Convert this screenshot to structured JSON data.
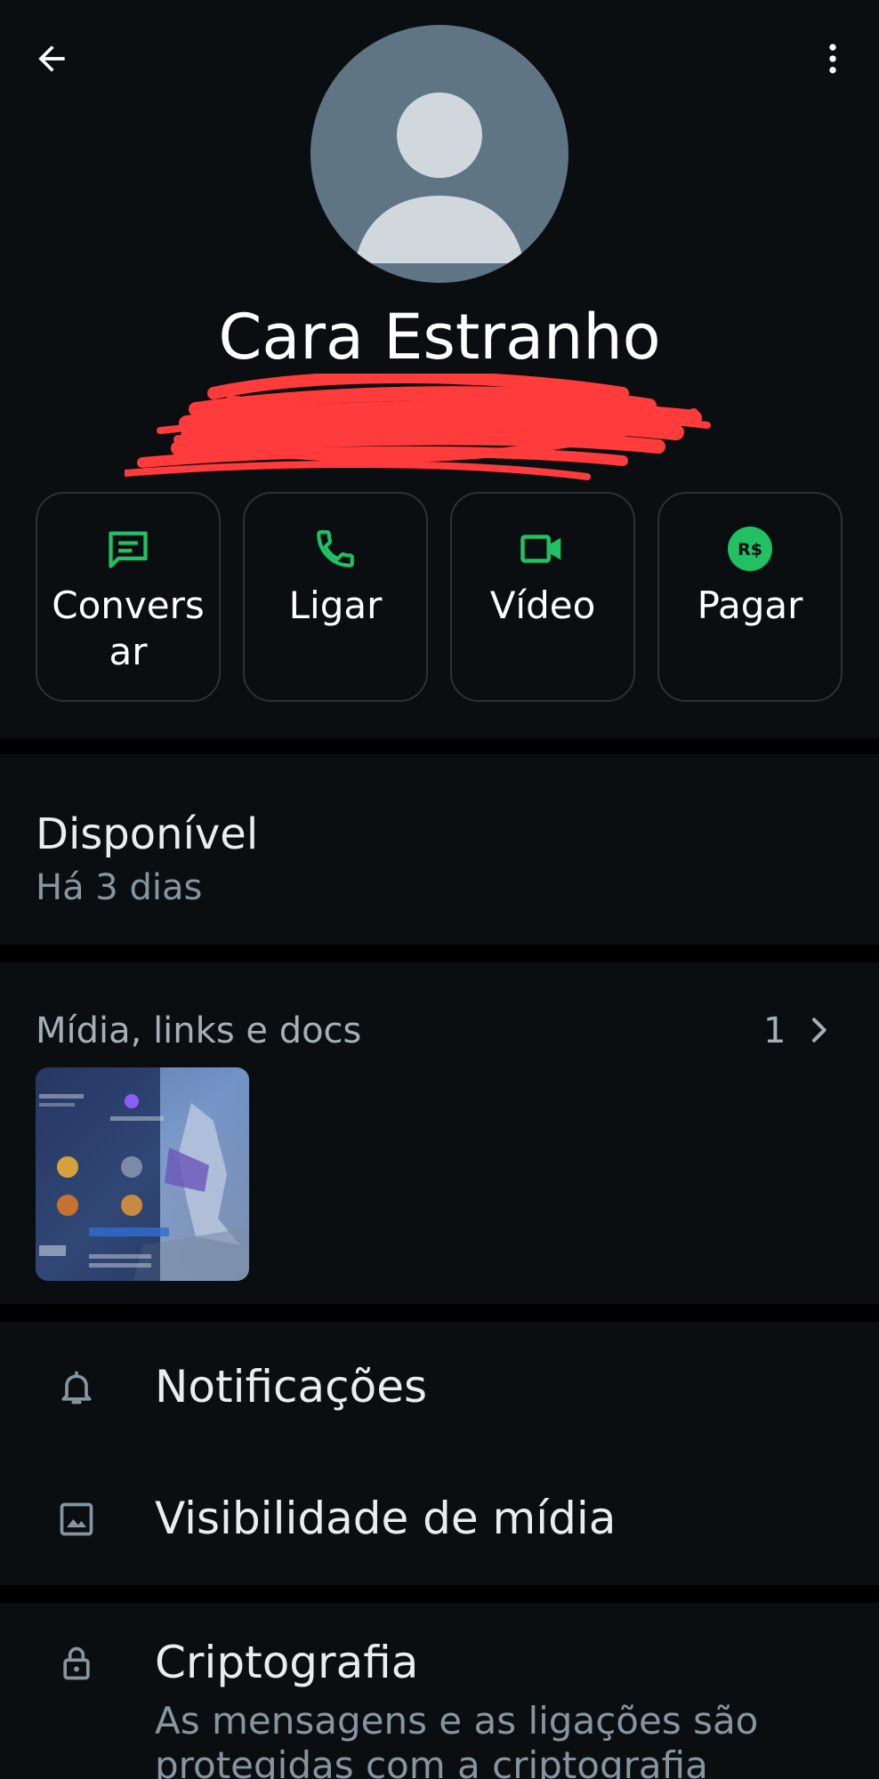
{
  "contact": {
    "name": "Cara Estranho"
  },
  "header": {
    "back_icon": "arrow-left-icon",
    "menu_icon": "more-vertical-icon"
  },
  "actions": [
    {
      "label": "Conversar",
      "icon": "message-icon"
    },
    {
      "label": "Ligar",
      "icon": "phone-icon"
    },
    {
      "label": "Vídeo",
      "icon": "video-icon"
    },
    {
      "label": "Pagar",
      "icon": "payment-icon",
      "icon_text": "R$"
    }
  ],
  "status": {
    "title": "Disponível",
    "time": "Há 3 dias"
  },
  "media": {
    "title": "Mídia, links e docs",
    "count": "1"
  },
  "settings": [
    {
      "label": "Notificações",
      "icon": "bell-icon"
    },
    {
      "label": "Visibilidade de mídia",
      "icon": "image-icon"
    }
  ],
  "encryption": {
    "label": "Criptografia",
    "icon": "lock-icon",
    "description": "As mensagens e as ligações são protegidas com a criptografia"
  },
  "colors": {
    "accent": "#21c063",
    "background": "#0b0e11",
    "divider": "#000000",
    "avatar": "#5f7584",
    "redaction": "#ff3b3b"
  }
}
